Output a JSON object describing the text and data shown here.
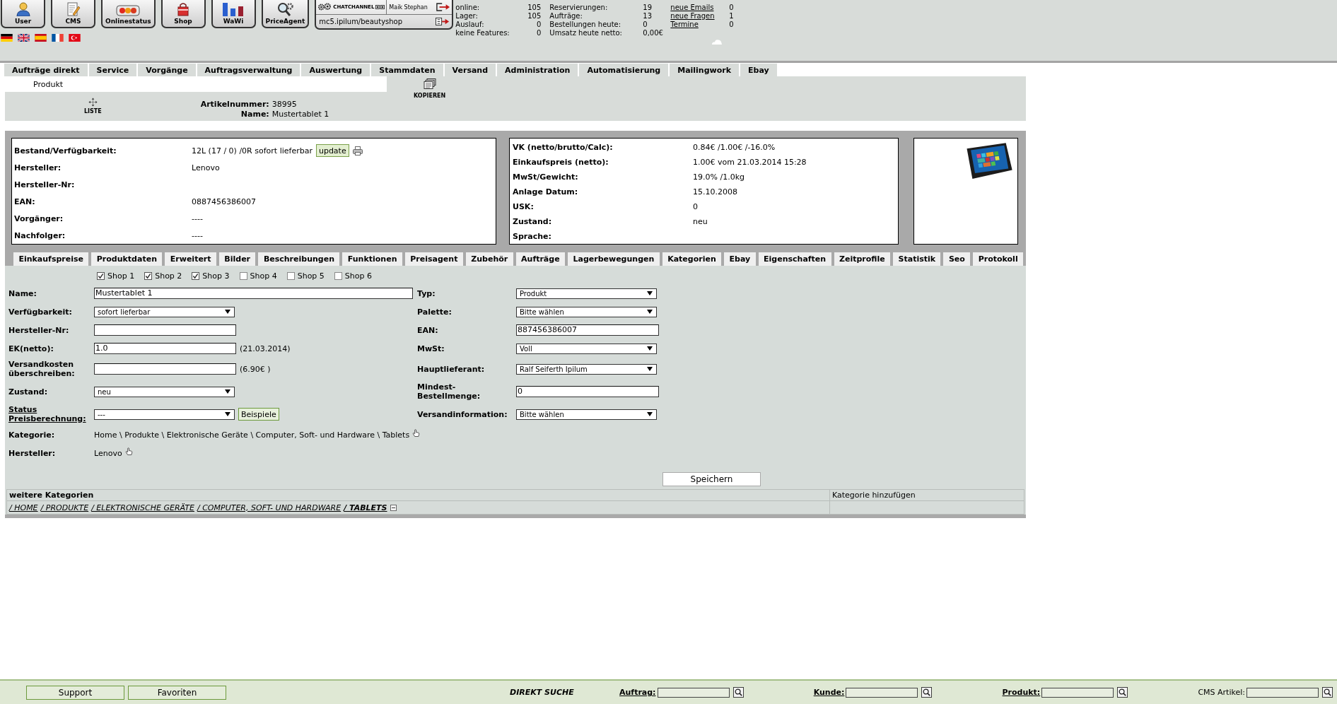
{
  "toolbar": {
    "apps": [
      {
        "kind": "user",
        "label": "User"
      },
      {
        "kind": "cms",
        "label": "CMS"
      },
      {
        "kind": "status",
        "label": "Onlinestatus"
      },
      {
        "kind": "shop",
        "label": "Shop"
      },
      {
        "kind": "wawi",
        "label": "WaWi"
      },
      {
        "kind": "agent",
        "label": "PriceAgent"
      }
    ],
    "chat": {
      "brand": "CHATCHANNEL",
      "user": "Maik Stephan",
      "address": "mc5.ipilum/beautyshop"
    }
  },
  "stats": {
    "columns": [
      [
        {
          "label": "online:",
          "value": "105"
        },
        {
          "label": "Lager:",
          "value": "105"
        },
        {
          "label": "Auslauf:",
          "value": "0"
        },
        {
          "label": "keine Features:",
          "value": "0"
        }
      ],
      [
        {
          "label": "Reservierungen:",
          "value": "19"
        },
        {
          "label": "Aufträge:",
          "value": "13"
        },
        {
          "label": "Bestellungen heute:",
          "value": "0"
        },
        {
          "label": "Umsatz heute netto:",
          "value": "0,00€"
        }
      ]
    ],
    "links": [
      {
        "label": "neue Emails",
        "value": "0"
      },
      {
        "label": "neue Fragen",
        "value": "1"
      },
      {
        "label": "Termine",
        "value": "0"
      }
    ]
  },
  "menu": [
    "Aufträge direkt",
    "Service",
    "Vorgänge",
    "Auftragsverwaltung",
    "Auswertung",
    "Stammdaten",
    "Versand",
    "Administration",
    "Automatisierung",
    "Mailingwork",
    "Ebay"
  ],
  "product": {
    "title": "Produkt",
    "copy": "KOPIEREN",
    "list": "LISTE",
    "fields": [
      {
        "label": "Artikelnummer:",
        "value": "38995"
      },
      {
        "label": "Name:",
        "value": "Mustertablet 1"
      }
    ]
  },
  "info": {
    "stock": [
      {
        "label": "Bestand/Verfügbarkeit:",
        "value": "12L (17 / 0) /0R sofort lieferbar",
        "button": "update"
      },
      {
        "label": "Hersteller:",
        "value": "Lenovo"
      },
      {
        "label": "Hersteller-Nr:"
      },
      {
        "label": "EAN:",
        "value": "0887456386007"
      },
      {
        "label": "Vorgänger:",
        "value": "----"
      },
      {
        "label": "Nachfolger:",
        "value": "----"
      }
    ],
    "prices": [
      {
        "label": "VK (netto/brutto/Calc):",
        "value": "0.84€ /1.00€ /-16.0%"
      },
      {
        "label": "Einkaufspreis (netto):",
        "value": "1.00€ vom 21.03.2014 15:28"
      },
      {
        "label": "MwSt/Gewicht:",
        "value": "19.0% /1.0kg"
      },
      {
        "label": "Anlage Datum:",
        "value": "15.10.2008"
      },
      {
        "label": "USK:",
        "value": "0"
      },
      {
        "label": "Zustand:",
        "value": "neu"
      },
      {
        "label": "Sprache:"
      }
    ]
  },
  "tabs": [
    "Einkaufspreise",
    "Produktdaten",
    "Erweitert",
    "Bilder",
    "Beschreibungen",
    "Funktionen",
    "Preisagent",
    "Zubehör",
    "Aufträge",
    "Lagerbewegungen",
    "Kategorien",
    "Ebay",
    "Eigenschaften",
    "Zeitprofile",
    "Statistik",
    "Seo",
    "Protokoll"
  ],
  "form": {
    "shops": [
      {
        "label": "Shop 1",
        "checked": true
      },
      {
        "label": "Shop 2",
        "checked": true
      },
      {
        "label": "Shop 3",
        "checked": true
      },
      {
        "label": "Shop 4",
        "checked": false
      },
      {
        "label": "Shop 5",
        "checked": false
      },
      {
        "label": "Shop 6",
        "checked": false
      }
    ],
    "left": [
      {
        "kind": "long-text",
        "label": "Name:",
        "value": "Mustertablet 1",
        "link": false
      },
      {
        "kind": "select",
        "label": "Verfügbarkeit:",
        "value": "sofort lieferbar",
        "link": false
      },
      {
        "kind": "text",
        "label": "Hersteller-Nr:",
        "link": false
      },
      {
        "kind": "text",
        "label": "EK(netto):",
        "value": "1.0",
        "note": "(21.03.2014)",
        "link": false
      },
      {
        "kind": "text",
        "label": "Versandkosten überschreiben:",
        "note": "(6.90€ )",
        "link": false
      },
      {
        "kind": "select",
        "label": "Zustand:",
        "value": "neu",
        "link": false
      },
      {
        "kind": "select",
        "label": "Status Preisberechnung:",
        "value": "---",
        "button": "Beispiele",
        "link": true
      },
      {
        "kind": "path",
        "label": "Kategorie:",
        "value": "Home \\ Produkte \\ Elektronische Geräte \\ Computer, Soft- und Hardware \\ Tablets",
        "link": false
      },
      {
        "kind": "path",
        "label": "Hersteller:",
        "value": "Lenovo",
        "link": false
      }
    ],
    "right": [
      {
        "kind": "select",
        "label": "Typ:",
        "value": "Produkt"
      },
      {
        "kind": "select",
        "label": "Palette:",
        "value": "Bitte wählen"
      },
      {
        "kind": "text",
        "label": "EAN:",
        "value": "887456386007"
      },
      {
        "kind": "select",
        "label": "MwSt:",
        "value": "Voll"
      },
      {
        "kind": "select",
        "label": "Hauptlieferant:",
        "value": "Ralf Seiferth Ipilum"
      },
      {
        "kind": "text",
        "label": "Mindest-Bestellmenge:",
        "value": "0"
      },
      {
        "kind": "select",
        "label": "Versandinformation:",
        "value": "Bitte wählen"
      }
    ],
    "save": "Speichern"
  },
  "categories": {
    "header": "weitere Kategorien",
    "add": "Kategorie hinzufügen",
    "path": [
      {
        "label": "/ HOME",
        "current": false
      },
      {
        "label": "/ PRODUKTE",
        "current": false
      },
      {
        "label": "/ ELEKTRONISCHE GERÄTE",
        "current": false
      },
      {
        "label": "/ COMPUTER, SOFT- UND HARDWARE",
        "current": false
      },
      {
        "label": "/ TABLETS",
        "current": true
      }
    ]
  },
  "footer": {
    "buttons": [
      "Support",
      "Favoriten"
    ],
    "title": "DIREKT SUCHE",
    "searches": [
      {
        "label": "Auftrag:",
        "link": true
      },
      {
        "label": "Kunde:",
        "link": true
      },
      {
        "label": "Produkt:",
        "link": true
      },
      {
        "label": "CMS Artikel:",
        "link": false
      }
    ]
  }
}
